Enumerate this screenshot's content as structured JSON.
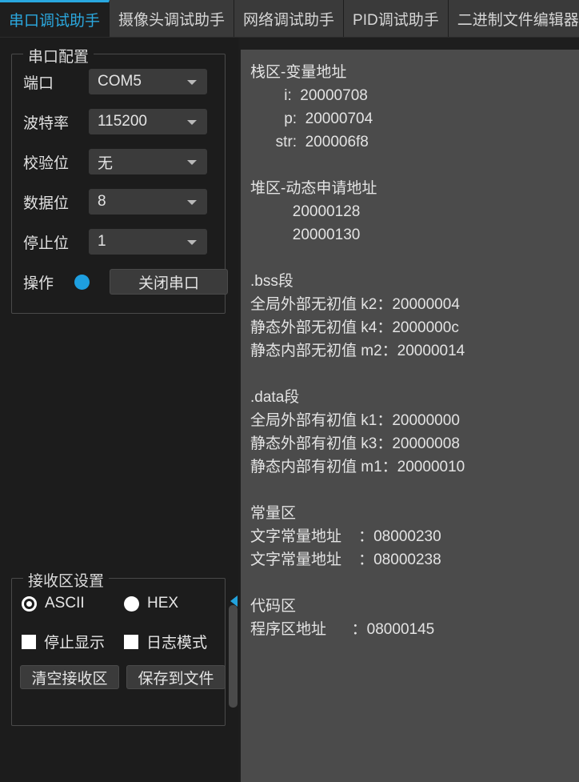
{
  "tabs": [
    {
      "label": "串口调试助手",
      "active": true
    },
    {
      "label": "摄像头调试助手",
      "active": false
    },
    {
      "label": "网络调试助手",
      "active": false
    },
    {
      "label": "PID调试助手",
      "active": false
    },
    {
      "label": "二进制文件编辑器",
      "active": false
    }
  ],
  "colors": {
    "accent": "#29a8e0",
    "window_bg": "#1e1e1e",
    "panel_bg": "#1c1c1c",
    "display_bg": "#4b4b4b",
    "control_bg": "#3b3b3b",
    "led_on": "#1e9fe0",
    "text": "#e3e3e3"
  },
  "serial_config": {
    "title": "串口配置",
    "rows": [
      {
        "label": "端口",
        "value": "COM5",
        "icon": "chevron-down-icon"
      },
      {
        "label": "波特率",
        "value": "115200",
        "icon": "chevron-down-icon"
      },
      {
        "label": "校验位",
        "value": "无",
        "icon": "chevron-down-icon"
      },
      {
        "label": "数据位",
        "value": "8",
        "icon": "chevron-down-icon"
      },
      {
        "label": "停止位",
        "value": "1",
        "icon": "chevron-down-icon"
      }
    ],
    "action_label": "操作",
    "status_indicator": "led-indicator-on",
    "action_button": "关闭串口"
  },
  "receive_settings": {
    "title": "接收区设置",
    "radios": [
      {
        "label": "ASCII",
        "checked": true
      },
      {
        "label": "HEX",
        "checked": false
      }
    ],
    "checkboxes": [
      {
        "label": "停止显示",
        "checked": false
      },
      {
        "label": "日志模式",
        "checked": false
      }
    ],
    "buttons": [
      {
        "label": "清空接收区"
      },
      {
        "label": "保存到文件"
      }
    ]
  },
  "splitter": {
    "handle_icon": "triangle-left-icon"
  },
  "display": {
    "lines": [
      "栈区-变量地址",
      "        i:  20000708",
      "        p:  20000704",
      "      str:  200006f8",
      "",
      "堆区-动态申请地址",
      "          20000128",
      "          20000130",
      "",
      ".bss段",
      "全局外部无初值 k2：20000004",
      "静态外部无初值 k4：2000000c",
      "静态内部无初值 m2：20000014",
      "",
      ".data段",
      "全局外部有初值 k1：20000000",
      "静态外部有初值 k3：20000008",
      "静态内部有初值 m1：20000010",
      "",
      "常量区",
      "文字常量地址    ：08000230",
      "文字常量地址    ：08000238",
      "",
      "代码区",
      "程序区地址      ：08000145"
    ]
  }
}
